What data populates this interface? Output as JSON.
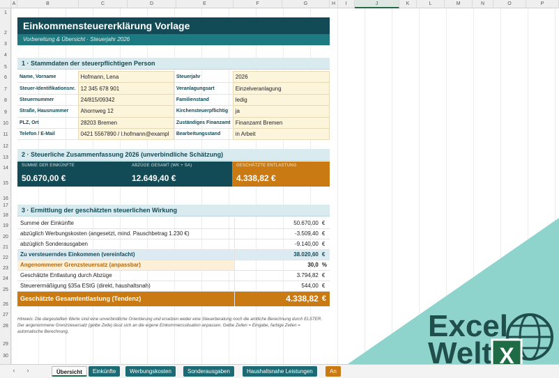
{
  "columns": [
    "A",
    "B",
    "C",
    "D",
    "E",
    "F",
    "G",
    "H",
    "I",
    "J",
    "K",
    "L",
    "M",
    "N",
    "O",
    "P"
  ],
  "selected_column": "J",
  "rows": [
    "1",
    "2",
    "3",
    "4",
    "5",
    "6",
    "7",
    "8",
    "9",
    "10",
    "11",
    "12",
    "13",
    "14",
    "15",
    "16",
    "17",
    "18",
    "19",
    "20",
    "21",
    "22",
    "23",
    "24",
    "25",
    "26",
    "27",
    "28",
    "29",
    "30"
  ],
  "title": "Einkommensteuererklärung Vorlage",
  "subtitle": "Vorbereitung & Übersicht · Steuerjahr 2026",
  "section1": {
    "heading": "1 · Stammdaten der steuerpflichtigen Person",
    "rows": [
      {
        "label": "Name, Vorname",
        "value": "Hofmann, Lena",
        "label2": "Steuerjahr",
        "value2": "2026"
      },
      {
        "label": "Steuer-Identifikationsnr.",
        "value": "12 345 678 901",
        "label2": "Veranlagungsart",
        "value2": "Einzelveranlagung"
      },
      {
        "label": "Steuernummer",
        "value": "24/815/09342",
        "label2": "Familienstand",
        "value2": "ledig"
      },
      {
        "label": "Straße, Hausnummer",
        "value": "Ahornweg 12",
        "label2": "Kirchensteuerpflichtig",
        "value2": "ja"
      },
      {
        "label": "PLZ, Ort",
        "value": "28203 Bremen",
        "label2": "Zuständiges Finanzamt",
        "value2": "Finanzamt Bremen"
      },
      {
        "label": "Telefon / E-Mail",
        "value": "0421 5567890 / l.hofmann@exampl",
        "label2": "Bearbeitungsstand",
        "value2": "in Arbeit"
      }
    ]
  },
  "section2": {
    "heading": "2 · Steuerliche Zusammenfassung 2026  (unverbindliche Schätzung)",
    "kpis": [
      {
        "label": "Summe der Einkünfte",
        "value": "50.670,00  €"
      },
      {
        "label": "Abzüge gesamt (WK + SA)",
        "value": "12.649,40  €"
      },
      {
        "label": "Geschätzte Entlastung",
        "value": "4.338,82  €"
      }
    ]
  },
  "section3": {
    "heading": "3 · Ermittlung der geschätzten steuerlichen Wirkung",
    "rows": [
      {
        "label": "Summe der Einkünfte",
        "value": "50.670,00",
        "unit": "€"
      },
      {
        "label": "abzüglich Werbungskosten (angesetzt, mind. Pauschbetrag 1.230 €)",
        "value": "-3.509,40",
        "unit": "€"
      },
      {
        "label": "abzüglich Sonderausgaben",
        "value": "-9.140,00",
        "unit": "€"
      },
      {
        "label": "Zu versteuerndes Einkommen (vereinfacht)",
        "value": "38.020,60",
        "unit": "€"
      },
      {
        "label": "Angenommener Grenzsteuersatz  (anpassbar)",
        "value": "30,0",
        "unit": "%"
      },
      {
        "label": "Geschätzte Entlastung durch Abzüge",
        "value": "3.794,82",
        "unit": "€"
      },
      {
        "label": "Steuerermäßigung §35a EStG (direkt, haushaltsnah)",
        "value": "544,00",
        "unit": "€"
      },
      {
        "label": "Geschätzte Gesamtentlastung (Tendenz)",
        "value": "4.338,82",
        "unit": "€"
      }
    ]
  },
  "hint": "Hinweis: Die dargestellten Werte sind eine unverbindliche Orientierung und ersetzen weder eine Steuerberatung noch die amtliche Berechnung durch ELSTER. Der angenommene Grenzsteuersatz (gelbe Zelle) lässt sich an die eigene Einkommenssituation anpassen. Gelbe Zellen = Eingabe, farbige Zellen = automatische Berechnung.",
  "tabs": [
    "Übersicht",
    "Einkünfte",
    "Werbungskosten",
    "Sonderausgaben",
    "Haushaltsnahe Leistungen",
    "An"
  ],
  "brand": {
    "line1": "Excel",
    "line2": "Welt",
    "badge": "X"
  },
  "colors": {
    "teal_dark": "#124a56",
    "teal": "#1c7a80",
    "orange": "#c97a12",
    "input_yellow": "#fdf4dc",
    "brand_mint": "#8fd3cd",
    "brand_dark": "#1f4e4b",
    "excel_green": "#1e6b45"
  }
}
